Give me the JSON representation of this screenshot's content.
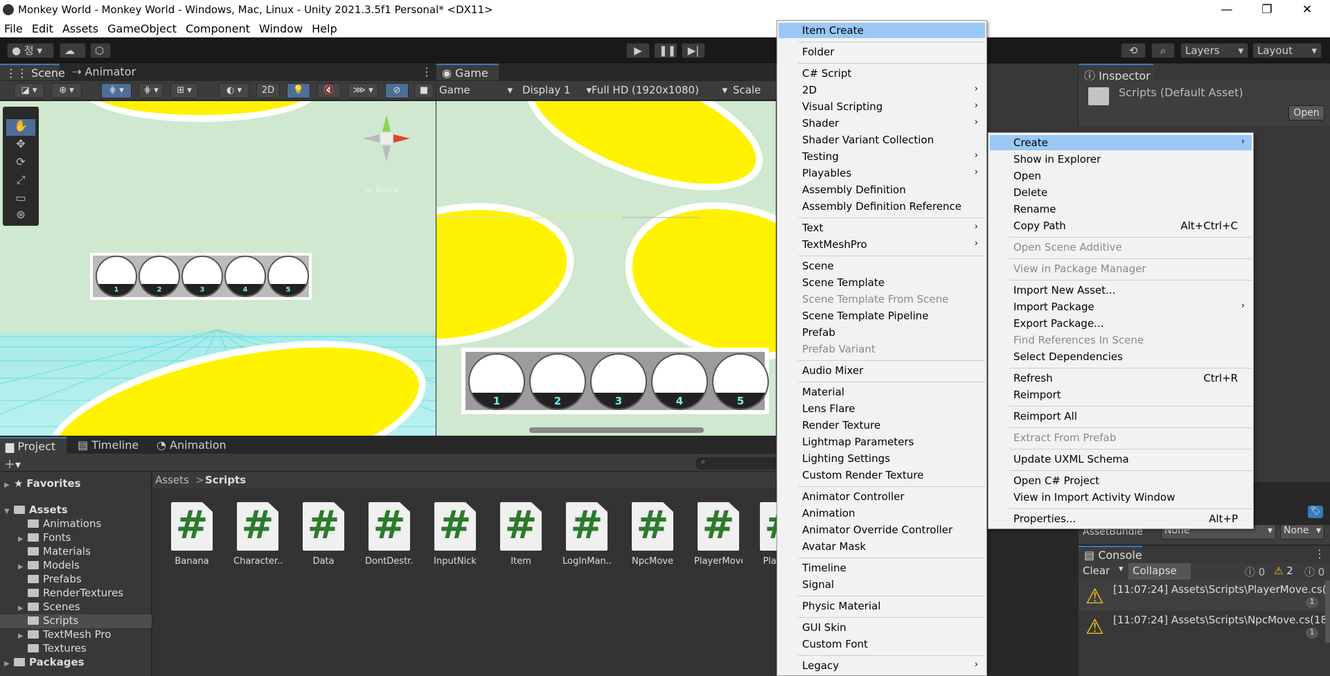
{
  "window": {
    "title": "Monkey World - Monkey World - Windows, Mac, Linux - Unity 2021.3.5f1 Personal* <DX11>",
    "minimize": "—",
    "maximize": "❐",
    "close": "✕"
  },
  "menubar": [
    "File",
    "Edit",
    "Assets",
    "GameObject",
    "Component",
    "Window",
    "Help"
  ],
  "toolbar": {
    "account": "정",
    "layers": "Layers",
    "layout": "Layout"
  },
  "scene_panel": {
    "tabs": [
      "Scene",
      "Animator"
    ],
    "mode_2d": "2D",
    "gizmo_label": "< Back",
    "slots": [
      "1",
      "2",
      "3",
      "4",
      "5"
    ]
  },
  "game_panel": {
    "tab": "Game",
    "game_dropdown": "Game",
    "display": "Display 1",
    "resolution": "Full HD (1920x1080)",
    "scale": "Scale",
    "slots": [
      "1",
      "2",
      "3",
      "4",
      "5"
    ]
  },
  "inspector": {
    "tab": "Inspector",
    "title": "Scripts (Default Asset)",
    "open_button": "Open",
    "assetbundle_label": "AssetBundle",
    "assetbundle_value": "None",
    "assetbundle_variant": "None"
  },
  "project_panel": {
    "tabs": [
      "Project",
      "Timeline",
      "Animation"
    ],
    "breadcrumb": [
      "Assets",
      "Scripts"
    ],
    "tree": [
      {
        "label": "Favorites",
        "level": 0,
        "kind": "star"
      },
      {
        "label": "Assets",
        "level": 0,
        "kind": "folder"
      },
      {
        "label": "Animations",
        "level": 1,
        "kind": "folder"
      },
      {
        "label": "Fonts",
        "level": 1,
        "kind": "folder"
      },
      {
        "label": "Materials",
        "level": 1,
        "kind": "folder"
      },
      {
        "label": "Models",
        "level": 1,
        "kind": "folder"
      },
      {
        "label": "Prefabs",
        "level": 1,
        "kind": "folder"
      },
      {
        "label": "RenderTextures",
        "level": 1,
        "kind": "folder"
      },
      {
        "label": "Scenes",
        "level": 1,
        "kind": "folder"
      },
      {
        "label": "Scripts",
        "level": 1,
        "kind": "folder",
        "selected": true
      },
      {
        "label": "TextMesh Pro",
        "level": 1,
        "kind": "folder"
      },
      {
        "label": "Textures",
        "level": 1,
        "kind": "folder"
      },
      {
        "label": "Packages",
        "level": 0,
        "kind": "folder"
      }
    ],
    "assets": [
      "Banana",
      "Character...",
      "Data",
      "DontDestr...",
      "InputNick",
      "Item",
      "LogInMan...",
      "NpcMove",
      "PlayerMove",
      "Play"
    ]
  },
  "console": {
    "tab": "Console",
    "clear": "Clear",
    "collapse": "Collapse",
    "log_count": "0",
    "warn_count": "2",
    "error_count": "0",
    "entries": [
      {
        "text": "[11:07:24] Assets\\Scripts\\PlayerMove.cs(",
        "count": "1"
      },
      {
        "text": "[11:07:24] Assets\\Scripts\\NpcMove.cs(18",
        "count": "1"
      }
    ]
  },
  "context_menu": {
    "items": [
      {
        "label": "Item Create",
        "selected": true
      },
      {
        "sep": true
      },
      {
        "label": "Folder"
      },
      {
        "sep": true
      },
      {
        "label": "C# Script"
      },
      {
        "label": "2D",
        "submenu": true
      },
      {
        "label": "Visual Scripting",
        "submenu": true
      },
      {
        "label": "Shader",
        "submenu": true
      },
      {
        "label": "Shader Variant Collection"
      },
      {
        "label": "Testing",
        "submenu": true
      },
      {
        "label": "Playables",
        "submenu": true
      },
      {
        "label": "Assembly Definition"
      },
      {
        "label": "Assembly Definition Reference"
      },
      {
        "sep": true
      },
      {
        "label": "Text",
        "submenu": true
      },
      {
        "label": "TextMeshPro",
        "submenu": true
      },
      {
        "sep": true
      },
      {
        "label": "Scene"
      },
      {
        "label": "Scene Template"
      },
      {
        "label": "Scene Template From Scene",
        "disabled": true
      },
      {
        "label": "Scene Template Pipeline"
      },
      {
        "label": "Prefab"
      },
      {
        "label": "Prefab Variant",
        "disabled": true
      },
      {
        "sep": true
      },
      {
        "label": "Audio Mixer"
      },
      {
        "sep": true
      },
      {
        "label": "Material"
      },
      {
        "label": "Lens Flare"
      },
      {
        "label": "Render Texture"
      },
      {
        "label": "Lightmap Parameters"
      },
      {
        "label": "Lighting Settings"
      },
      {
        "label": "Custom Render Texture"
      },
      {
        "sep": true
      },
      {
        "label": "Animator Controller"
      },
      {
        "label": "Animation"
      },
      {
        "label": "Animator Override Controller"
      },
      {
        "label": "Avatar Mask"
      },
      {
        "sep": true
      },
      {
        "label": "Timeline"
      },
      {
        "label": "Signal"
      },
      {
        "sep": true
      },
      {
        "label": "Physic Material"
      },
      {
        "sep": true
      },
      {
        "label": "GUI Skin"
      },
      {
        "label": "Custom Font"
      },
      {
        "sep": true
      },
      {
        "label": "Legacy",
        "submenu": true
      }
    ]
  },
  "assets_menu": {
    "items": [
      {
        "label": "Create",
        "submenu": true,
        "selected": true
      },
      {
        "label": "Show in Explorer"
      },
      {
        "label": "Open"
      },
      {
        "label": "Delete"
      },
      {
        "label": "Rename"
      },
      {
        "label": "Copy Path",
        "shortcut": "Alt+Ctrl+C"
      },
      {
        "sep": true
      },
      {
        "label": "Open Scene Additive",
        "disabled": true
      },
      {
        "sep": true
      },
      {
        "label": "View in Package Manager",
        "disabled": true
      },
      {
        "sep": true
      },
      {
        "label": "Import New Asset..."
      },
      {
        "label": "Import Package",
        "submenu": true
      },
      {
        "label": "Export Package..."
      },
      {
        "label": "Find References In Scene",
        "disabled": true
      },
      {
        "label": "Select Dependencies"
      },
      {
        "sep": true
      },
      {
        "label": "Refresh",
        "shortcut": "Ctrl+R"
      },
      {
        "label": "Reimport"
      },
      {
        "sep": true
      },
      {
        "label": "Reimport All"
      },
      {
        "sep": true
      },
      {
        "label": "Extract From Prefab",
        "disabled": true
      },
      {
        "sep": true
      },
      {
        "label": "Update UXML Schema"
      },
      {
        "sep": true
      },
      {
        "label": "Open C# Project"
      },
      {
        "label": "View in Import Activity Window"
      },
      {
        "sep": true
      },
      {
        "label": "Properties...",
        "shortcut": "Alt+P"
      }
    ]
  }
}
